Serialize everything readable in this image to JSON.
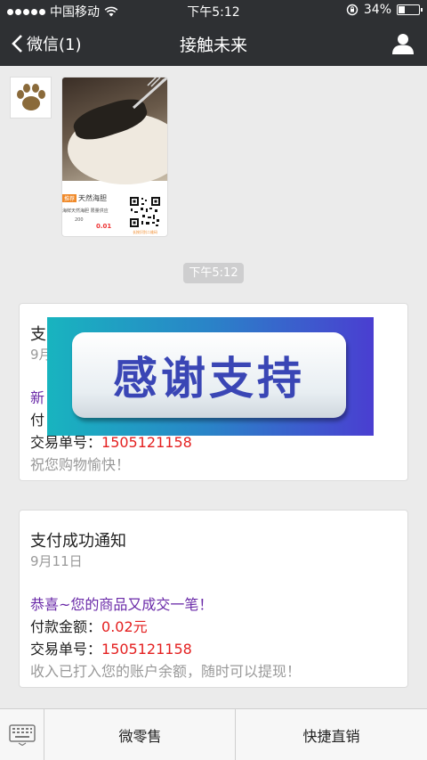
{
  "status_bar": {
    "carrier": "中国移动",
    "time": "下午5:12",
    "battery_percent": "34%",
    "battery_level": 0.34,
    "icons": [
      "signal-dots-icon",
      "wifi-icon",
      "orientation-lock-icon",
      "battery-icon"
    ]
  },
  "nav": {
    "back_label": "微信(1)",
    "title": "接触未来",
    "profile_icon": "person-icon"
  },
  "chat": {
    "avatar_icon": "paw-icon",
    "poster": {
      "tag": "推荐",
      "brand": "天然海胆",
      "subtitle": "海鲜天然海胆 限量供应",
      "qty": "200",
      "price": "0.01",
      "qr_caption": "长按识别二维码"
    },
    "timestamp": "下午5:12"
  },
  "cards": [
    {
      "title": "支",
      "date": "9月",
      "line1": "新",
      "line2": "付",
      "order_label": "交易单号：",
      "order_no": "1505121158",
      "footer": "祝您购物愉快！"
    },
    {
      "title": "支付成功通知",
      "date": "9月11日",
      "line1": "恭喜~您的商品又成交一笔！",
      "amount_label": "付款金额：",
      "amount": "0.02元",
      "order_label": "交易单号：",
      "order_no": "1505121158",
      "footer": "收入已打入您的账户余额，随时可以提现！"
    }
  ],
  "overlay": {
    "text": "感谢支持"
  },
  "bottom_bar": {
    "keyboard_icon": "keyboard-icon",
    "menu1": "微零售",
    "menu2": "快捷直销"
  },
  "colors": {
    "nav_bg": "#2e3033",
    "purple_text": "#6a2aa8",
    "red_text": "#e42020",
    "banner_gradient_start": "#18b4bf",
    "banner_gradient_end": "#4a3ed1"
  }
}
